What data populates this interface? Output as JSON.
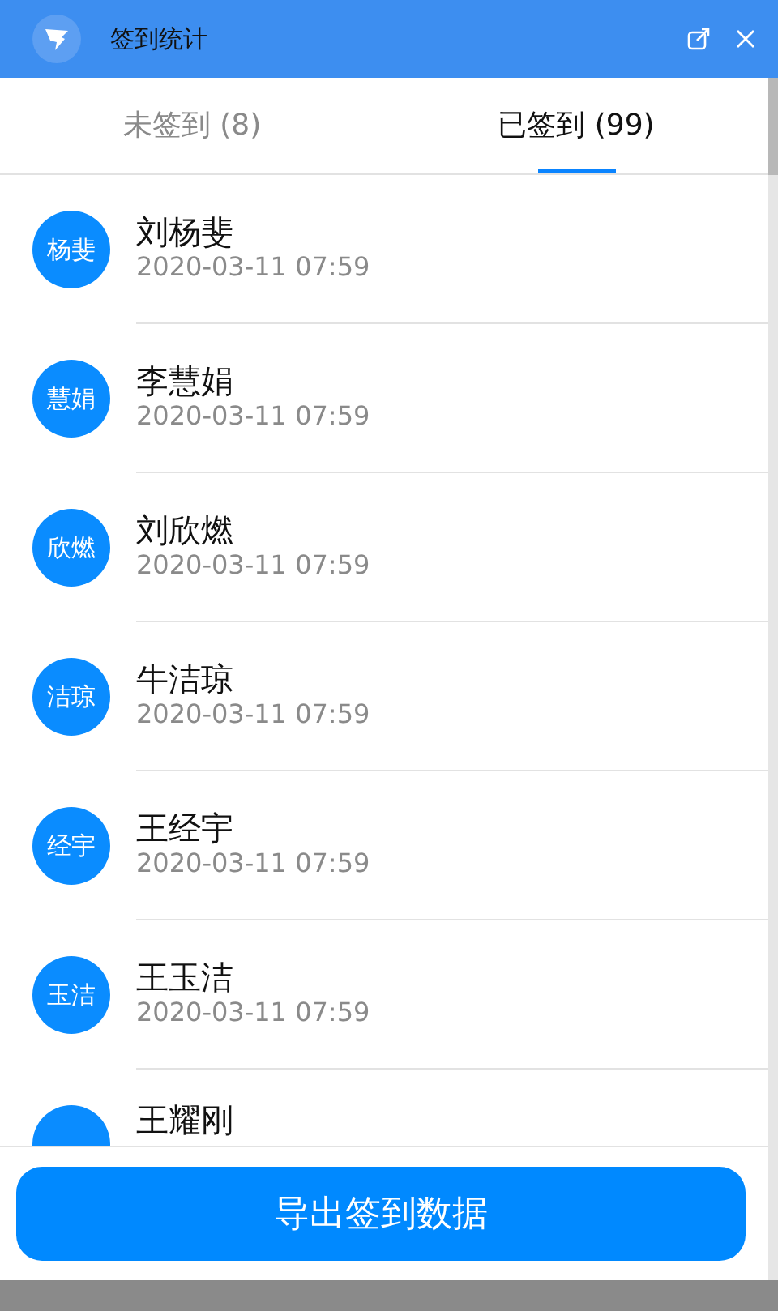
{
  "window": {
    "title": "签到统计"
  },
  "tabs": [
    {
      "label": "未签到 (8)",
      "selected": false
    },
    {
      "label": "已签到 (99)",
      "selected": true
    }
  ],
  "people": [
    {
      "avatar": "杨斐",
      "name": "刘杨斐",
      "time": "2020-03-11 07:59"
    },
    {
      "avatar": "慧娟",
      "name": "李慧娟",
      "time": "2020-03-11 07:59"
    },
    {
      "avatar": "欣燃",
      "name": "刘欣燃",
      "time": "2020-03-11 07:59"
    },
    {
      "avatar": "洁琼",
      "name": "牛洁琼",
      "time": "2020-03-11 07:59"
    },
    {
      "avatar": "经宇",
      "name": "王经宇",
      "time": "2020-03-11 07:59"
    },
    {
      "avatar": "玉洁",
      "name": "王玉洁",
      "time": "2020-03-11 07:59"
    },
    {
      "name": "王耀刚"
    }
  ],
  "export_button": "导出签到数据"
}
